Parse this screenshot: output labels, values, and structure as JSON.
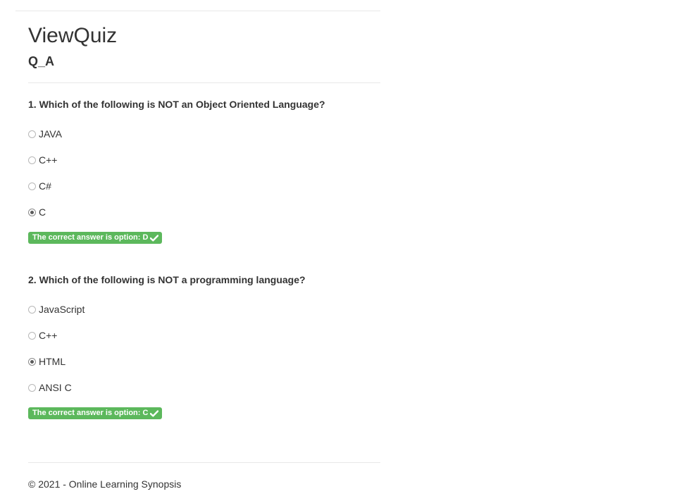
{
  "header": {
    "title": "ViewQuiz",
    "subtitle": "Q_A"
  },
  "questions": [
    {
      "text": "1. Which of the following is NOT an Object Oriented Language?",
      "options": [
        "JAVA",
        "C++",
        "C#",
        "C"
      ],
      "selected_index": 3,
      "answer_label": "The correct answer is option: D"
    },
    {
      "text": "2. Which of the following is NOT a programming language?",
      "options": [
        "JavaScript",
        "C++",
        "HTML",
        "ANSI C"
      ],
      "selected_index": 2,
      "answer_label": "The correct answer is option: C"
    }
  ],
  "footer": {
    "text": "© 2021 - Online Learning Synopsis"
  },
  "colors": {
    "success_badge": "#5cb85c",
    "text": "#333333",
    "divider": "#e8e8e8"
  },
  "icons": {
    "answer_badge": "check-icon"
  }
}
